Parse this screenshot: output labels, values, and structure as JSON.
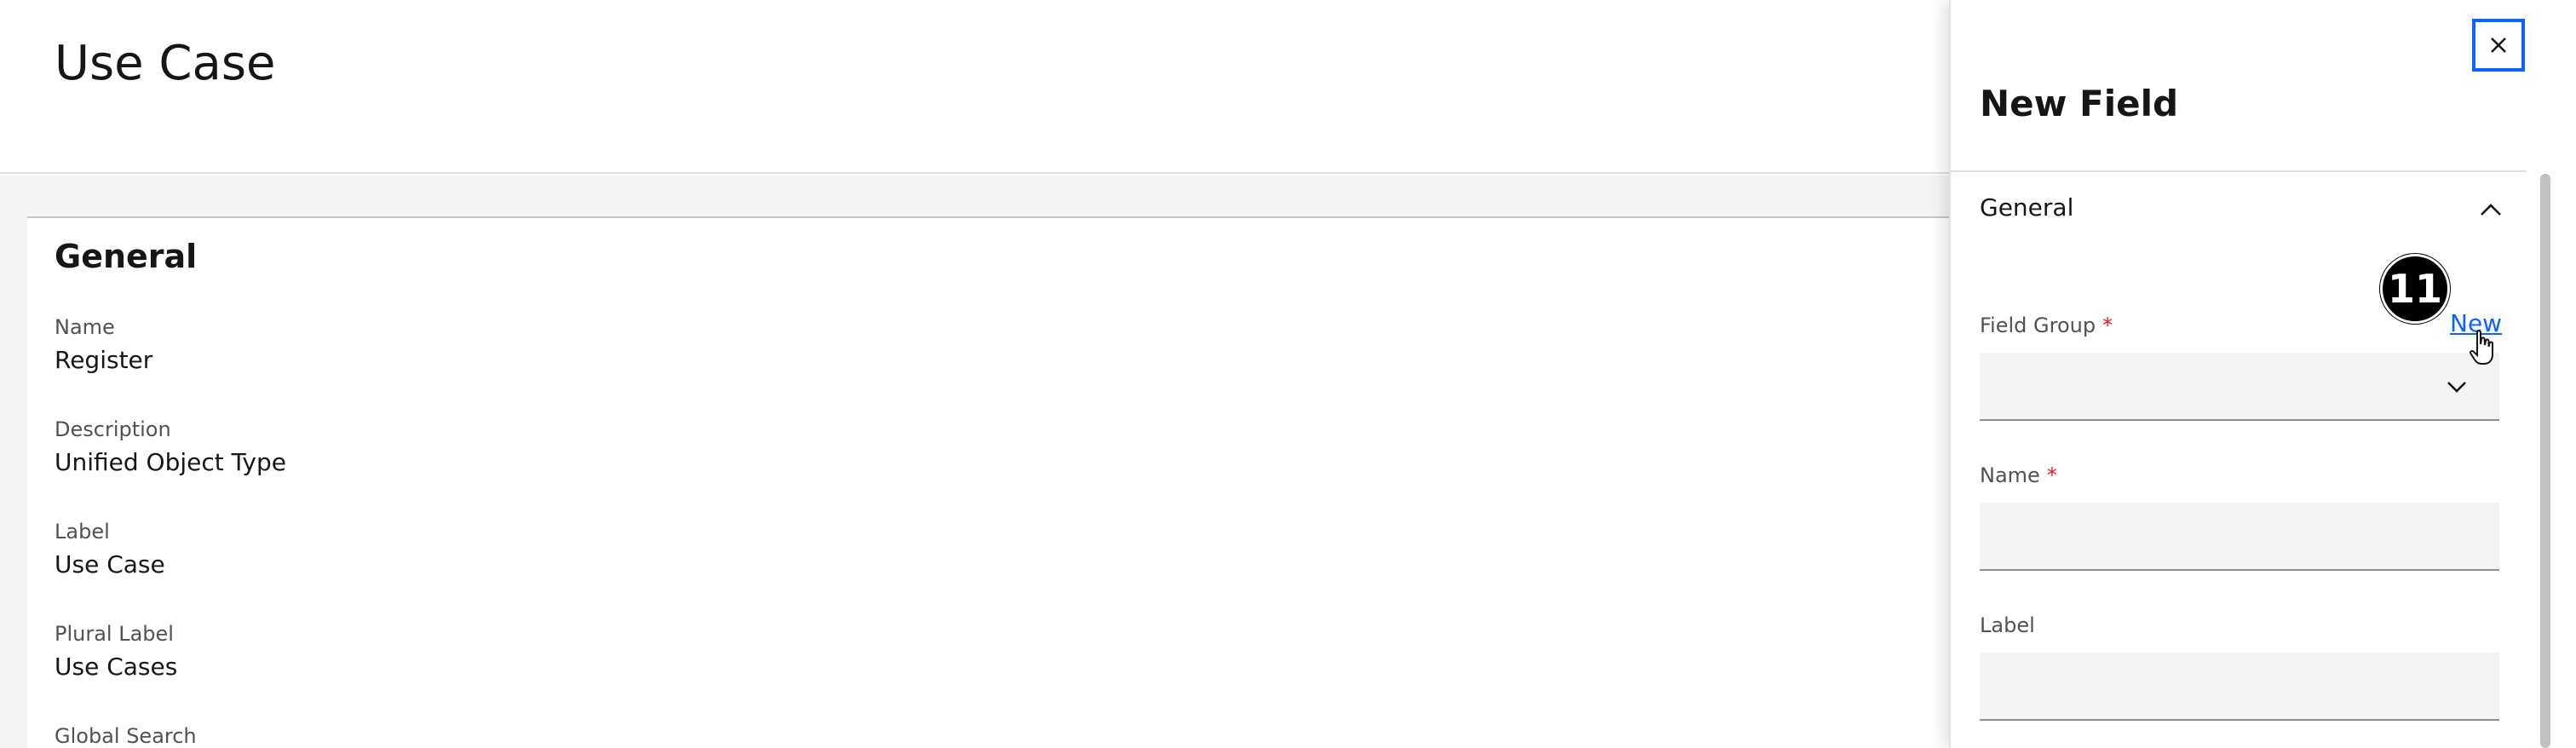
{
  "page": {
    "title": "Use Case",
    "section_title": "General",
    "fields": [
      {
        "label": "Name",
        "value": "Register"
      },
      {
        "label": "Description",
        "value": "Unified Object Type"
      },
      {
        "label": "Label",
        "value": "Use Case"
      },
      {
        "label": "Plural Label",
        "value": "Use Cases"
      },
      {
        "label": "Global Search",
        "value": ""
      }
    ]
  },
  "panel": {
    "title": "New Field",
    "close_icon": "close-icon",
    "accordion": {
      "title": "General",
      "state_icon": "chevron-up-icon"
    },
    "new_link": "New",
    "step_badge": "11",
    "form": {
      "field_group": {
        "label": "Field Group",
        "required_marker": "*",
        "value": "",
        "icon": "chevron-down-icon"
      },
      "name": {
        "label": "Name",
        "required_marker": "*",
        "value": ""
      },
      "label": {
        "label": "Label",
        "value": ""
      }
    }
  },
  "colors": {
    "accent": "#0f62fe",
    "required": "#da1e28",
    "field_bg": "#f4f4f4",
    "text_primary": "#161616",
    "text_secondary": "#525252"
  }
}
